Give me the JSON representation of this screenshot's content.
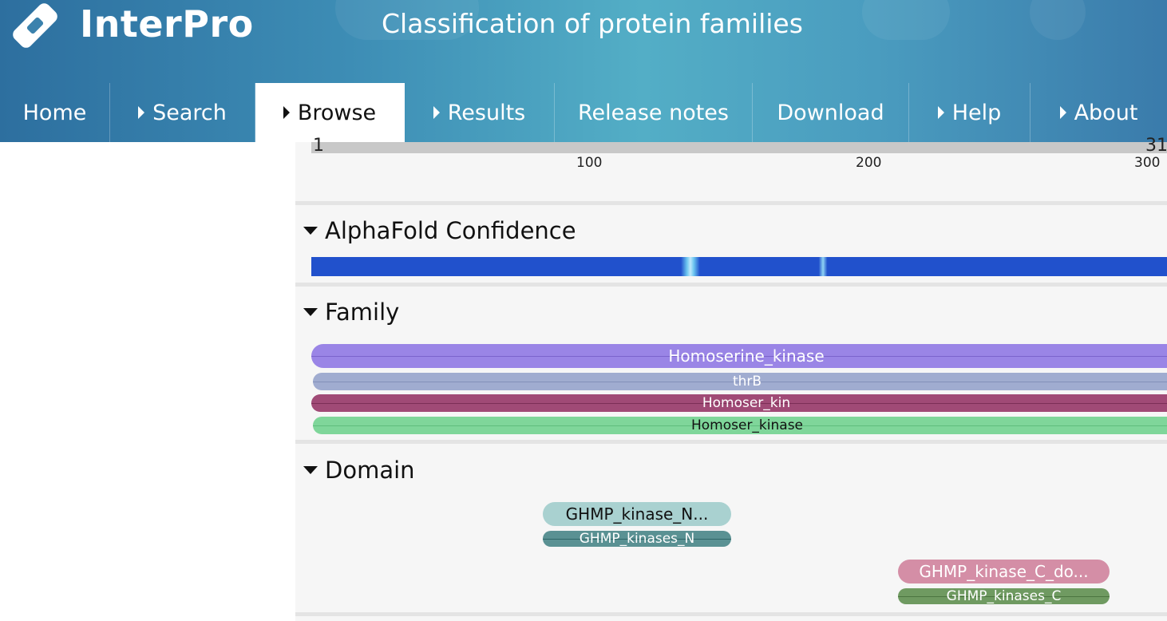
{
  "header": {
    "logo_text": "InterPro",
    "tagline": "Classification of protein families"
  },
  "nav": [
    {
      "label": "Home",
      "caret": false,
      "active": false
    },
    {
      "label": "Search",
      "caret": true,
      "active": false
    },
    {
      "label": "Browse",
      "caret": true,
      "active": true
    },
    {
      "label": "Results",
      "caret": true,
      "active": false
    },
    {
      "label": "Release notes",
      "caret": false,
      "active": false
    },
    {
      "label": "Download",
      "caret": false,
      "active": false
    },
    {
      "label": "Help",
      "caret": true,
      "active": false
    },
    {
      "label": "About",
      "caret": true,
      "active": false
    }
  ],
  "ruler": {
    "start_label": "1",
    "end_label": "31",
    "ticks": [
      "100",
      "200",
      "300"
    ]
  },
  "sections": {
    "alphafold": {
      "title": "AlphaFold Confidence"
    },
    "family": {
      "title": "Family",
      "tracks": [
        {
          "label": "Homoserine_kinase",
          "color": "#9a85e6",
          "text_color": "#ffffff"
        },
        {
          "label": "thrB",
          "color": "#a0acd0",
          "text_color": "#ffffff"
        },
        {
          "label": "Homoser_kin",
          "color": "#a04a76",
          "text_color": "#ffffff"
        },
        {
          "label": "Homoser_kinase",
          "color": "#7fd69a",
          "text_color": "#111111"
        }
      ]
    },
    "domain": {
      "title": "Domain",
      "tracks": [
        {
          "label": "GHMP_kinase_N...",
          "color": "#a9d1d0",
          "text_color": "#111111"
        },
        {
          "label": "GHMP_kinases_N",
          "color": "#5a9193",
          "text_color": "#ffffff"
        },
        {
          "label": "GHMP_kinase_C_do...",
          "color": "#d48ea6",
          "text_color": "#ffffff"
        },
        {
          "label": "GHMP_kinases_C",
          "color": "#6f9a61",
          "text_color": "#ffffff"
        }
      ]
    }
  }
}
